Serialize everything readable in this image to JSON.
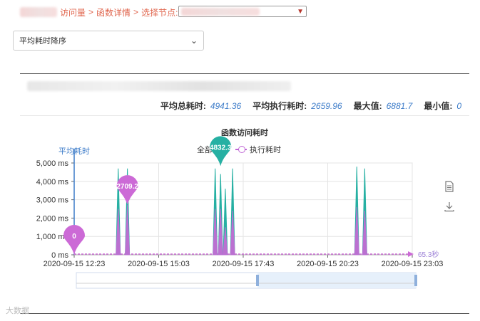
{
  "breadcrumb": {
    "visit_label": "访问量",
    "sep1": ">",
    "detail_label": "函数详情",
    "sep2": ">",
    "node_label": "选择节点:"
  },
  "sort": {
    "selected": "平均耗时降序"
  },
  "stats": {
    "avg_total_label": "平均总耗时:",
    "avg_total_value": "4941.36",
    "avg_exec_label": "平均执行耗时:",
    "avg_exec_value": "2659.96",
    "max_label": "最大值:",
    "max_value": "6881.7",
    "min_label": "最小值:",
    "min_value": "0"
  },
  "chart_data": {
    "type": "line",
    "title": "函数访问耗时",
    "ylabel": "平均耗时",
    "ylim": [
      0,
      5000
    ],
    "y_ticks": [
      "5,000 ms",
      "4,000 ms",
      "3,000 ms",
      "2,000 ms",
      "1,000 ms",
      "0 ms"
    ],
    "x_ticks": [
      "2020-09-15 12:23",
      "2020-09-15 15:03",
      "2020-09-15 17:43",
      "2020-09-15 20:23",
      "2020-09-15 23:03"
    ],
    "legend": [
      "全部耗时",
      "执行耗时"
    ],
    "colors": {
      "total": "#26b0a3",
      "exec": "#cc6ad6"
    },
    "x_end_label": "65.3秒",
    "spikes_hours": [
      13.77,
      14.06,
      16.83,
      17.0,
      17.15,
      17.38,
      21.3,
      21.55
    ],
    "total_values": [
      4700,
      4700,
      4700,
      4400,
      3600,
      4700,
      4800,
      4700
    ],
    "exec_values": [
      2500,
      2709.2,
      2500,
      2500,
      1500,
      2400,
      2600,
      2400
    ],
    "markers": [
      {
        "series": "total",
        "label": "4832.3",
        "x_hour": 17.0,
        "value": 4832.3
      },
      {
        "series": "exec",
        "label": "2709.2",
        "x_hour": 14.06,
        "value": 2709.2
      },
      {
        "series": "exec",
        "label": "0",
        "x_hour": 12.38,
        "value": 0
      }
    ],
    "x_range_hours": [
      12.38,
      23.05
    ]
  },
  "toolbox": {
    "data_view_icon": "document-icon",
    "save_icon": "download-icon"
  },
  "watermark": "大数据"
}
